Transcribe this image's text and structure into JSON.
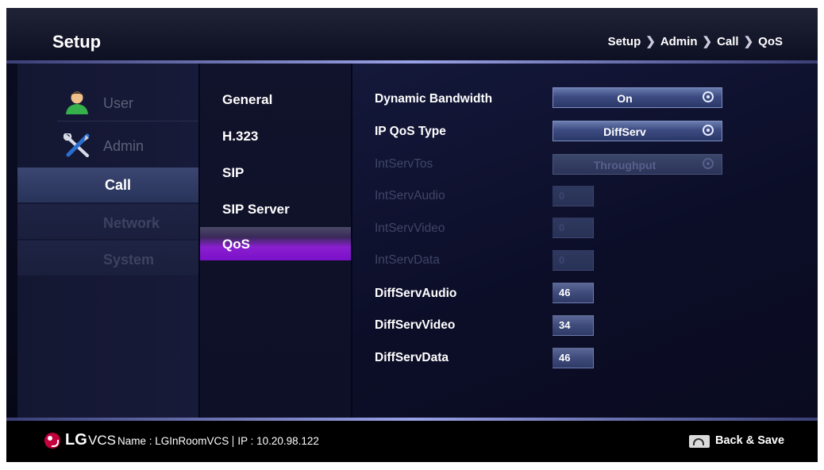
{
  "header": {
    "title": "Setup",
    "breadcrumb": [
      "Setup",
      "Admin",
      "Call",
      "QoS"
    ],
    "separator": "❯"
  },
  "left_menu": {
    "items": [
      {
        "label": "User",
        "icon": "user-icon",
        "state": "dim"
      },
      {
        "label": "Admin",
        "icon": "admin-tools-icon",
        "state": "dim"
      },
      {
        "label": "Call",
        "state": "selected"
      },
      {
        "label": "Network",
        "state": "disabled"
      },
      {
        "label": "System",
        "state": "disabled"
      }
    ]
  },
  "sub_menu": {
    "items": [
      "General",
      "H.323",
      "SIP",
      "SIP Server",
      "QoS"
    ],
    "selected": "QoS"
  },
  "settings": {
    "dynamic_bandwidth": {
      "label": "Dynamic Bandwidth",
      "value": "On"
    },
    "ip_qos_type": {
      "label": "IP QoS Type",
      "value": "DiffServ"
    },
    "intserv_tos": {
      "label": "IntServTos",
      "value": "Throughput"
    },
    "intserv_audio": {
      "label": "IntServAudio",
      "value": "0"
    },
    "intserv_video": {
      "label": "IntServVideo",
      "value": "0"
    },
    "intserv_data": {
      "label": "IntServData",
      "value": "0"
    },
    "diffserv_audio": {
      "label": "DiffServAudio",
      "value": "46"
    },
    "diffserv_video": {
      "label": "DiffServVideo",
      "value": "34"
    },
    "diffserv_data": {
      "label": "DiffServData",
      "value": "46"
    }
  },
  "footer": {
    "brand": "LG",
    "product": "VCS",
    "name_label": "Name : LGInRoomVCS",
    "ip_label": "IP : 10.20.98.122",
    "back_label": "Back & Save"
  },
  "colors": {
    "accent_purple": "#7a10c8",
    "selected_blue": "#3b4672",
    "lg_red": "#c4003c"
  }
}
